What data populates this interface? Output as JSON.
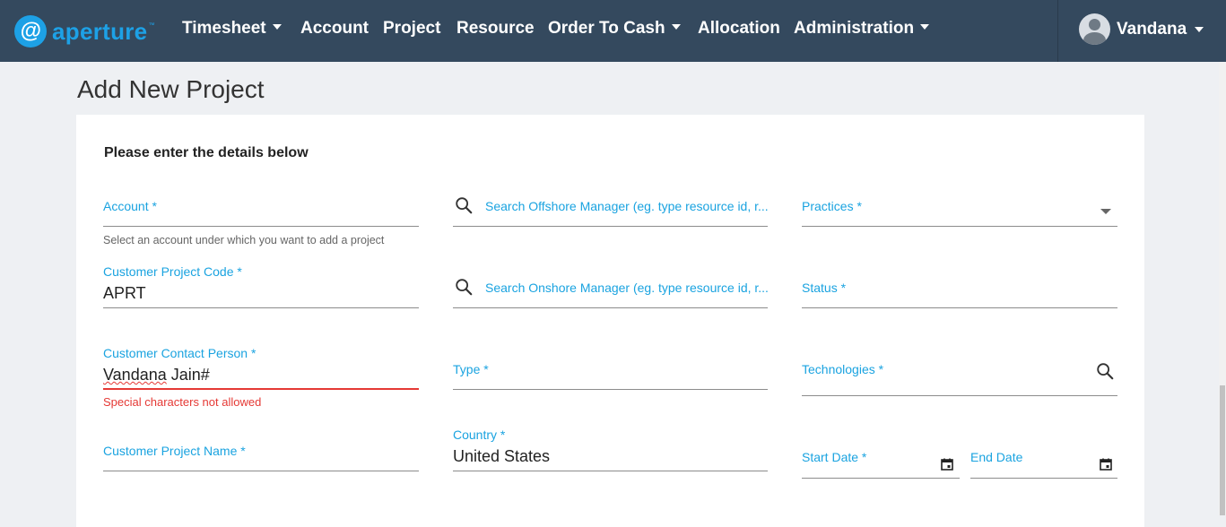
{
  "app": {
    "logo_glyph": "@",
    "logo_text": "aperture",
    "logo_tm": "™",
    "brand_color": "#1da1e6",
    "navbar_color": "#34495e"
  },
  "nav": {
    "timesheet": "Timesheet",
    "account": "Account",
    "project": "Project",
    "resource": "Resource",
    "order_to_cash": "Order To Cash",
    "allocation": "Allocation",
    "administration": "Administration"
  },
  "user": {
    "name": "Vandana"
  },
  "page": {
    "title": "Add New Project",
    "section_title": "Please enter the details below"
  },
  "form": {
    "account": {
      "label": "Account *",
      "hint": "Select an account under which you want to add a project"
    },
    "offshore_manager": {
      "placeholder": "Search Offshore Manager (eg. type resource id, r..."
    },
    "practices": {
      "label": "Practices *"
    },
    "customer_project_code": {
      "label": "Customer Project Code *",
      "value": "APRT"
    },
    "onshore_manager": {
      "placeholder": "Search Onshore Manager (eg. type resource id, r..."
    },
    "status": {
      "label": "Status *"
    },
    "customer_contact_person": {
      "label": "Customer Contact Person *",
      "value_word1": "Vandana",
      "value_rest": " Jain#",
      "error": "Special characters not allowed"
    },
    "type": {
      "label": "Type *"
    },
    "technologies": {
      "label": "Technologies *"
    },
    "customer_project_name": {
      "label": "Customer Project Name *"
    },
    "country": {
      "label": "Country *",
      "value": "United States"
    },
    "start_date": {
      "label": "Start Date *"
    },
    "end_date": {
      "label": "End Date"
    }
  },
  "colors": {
    "label": "#1aa3e0",
    "error": "#e53935"
  }
}
